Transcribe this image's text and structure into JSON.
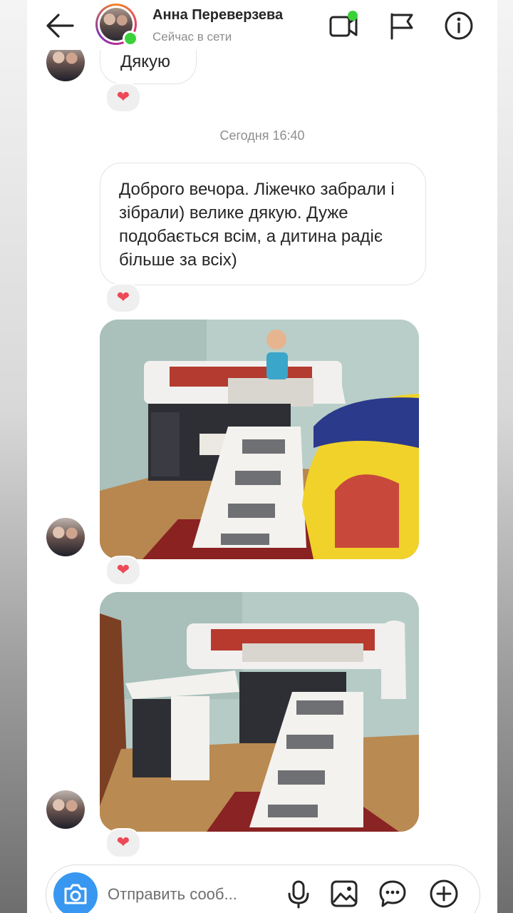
{
  "header": {
    "contact_name": "Анна Переверзева",
    "contact_status": "Сейчас в сети",
    "status_color": "#3ad13a"
  },
  "icons": {
    "back": "arrow-left-icon",
    "video": "video-camera-icon",
    "report": "flag-icon",
    "info": "info-icon",
    "camera": "camera-icon",
    "microphone": "microphone-icon",
    "gallery": "image-icon",
    "sticker": "chat-bubble-icon",
    "add": "plus-circle-icon",
    "reaction": "heart-icon"
  },
  "messages": [
    {
      "type": "text",
      "text": "Дякую",
      "reaction": "❤"
    },
    {
      "type": "timestamp",
      "text": "Сегодня 16:40"
    },
    {
      "type": "text",
      "text": "Доброго вечора. Ліжечко забрали і зібрали) велике дякую. Дуже подобається всім, а дитина радіє більше за всіх)",
      "reaction": "❤"
    },
    {
      "type": "photo",
      "reaction": "❤"
    },
    {
      "type": "photo",
      "reaction": "❤"
    }
  ],
  "composer": {
    "placeholder": "Отправить сооб..."
  },
  "colors": {
    "accent": "#3897f0",
    "heart": "#ed4956",
    "text": "#262626",
    "muted": "#8e8e8e"
  }
}
